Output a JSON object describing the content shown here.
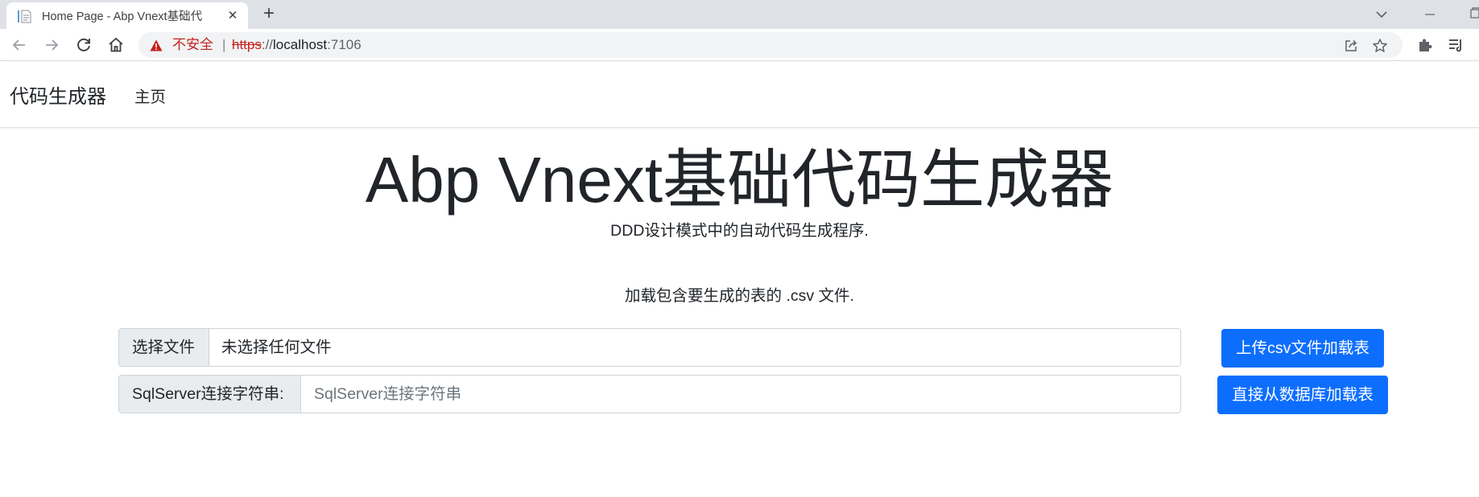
{
  "browser": {
    "tab": {
      "title": "Home Page - Abp Vnext基础代"
    },
    "address": {
      "security_label": "不安全",
      "separator": "|",
      "url_scheme": "https",
      "url_sep": "://",
      "url_host": "localhost",
      "url_port": ":7106"
    }
  },
  "navbar": {
    "brand": "代码生成器",
    "home_link": "主页"
  },
  "main": {
    "title": "Abp Vnext基础代码生成器",
    "subtitle": "DDD设计模式中的自动代码生成程序.",
    "load_hint": "加载包含要生成的表的 .csv 文件.",
    "file_input": {
      "button_label": "选择文件",
      "status": "未选择任何文件"
    },
    "connection": {
      "label": "SqlServer连接字符串:",
      "placeholder": "SqlServer连接字符串",
      "value": ""
    },
    "upload_button": "上传csv文件加载表",
    "db_button": "直接从数据库加载表"
  },
  "colors": {
    "primary": "#0d6efd",
    "insecure": "#c5221f",
    "tabstrip": "#dee1e6",
    "addon_bg": "#e9ecef"
  },
  "icons": [
    "document-icon",
    "close-icon",
    "plus-icon",
    "chevron-down-icon",
    "minimize-icon",
    "maximize-icon",
    "back-arrow-icon",
    "forward-arrow-icon",
    "reload-icon",
    "home-icon",
    "warning-icon",
    "share-icon",
    "star-icon",
    "puzzle-icon",
    "reading-list-icon"
  ]
}
